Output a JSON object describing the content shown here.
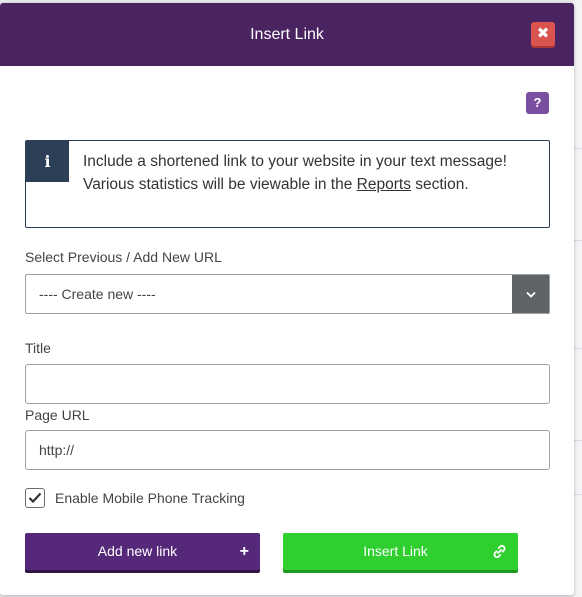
{
  "dialog": {
    "title": "Insert Link",
    "close_icon": "close-icon",
    "help_label": "?"
  },
  "info": {
    "icon": "i",
    "text_before": "Include a shortened link to your website in your text message! Various statistics will be viewable in the ",
    "link_text": "Reports",
    "text_after": " section."
  },
  "form": {
    "url_select": {
      "label": "Select Previous / Add New URL",
      "selected": "---- Create new ----"
    },
    "title_field": {
      "label": "Title",
      "value": ""
    },
    "page_url_field": {
      "label": "Page URL",
      "value": "http://"
    },
    "tracking": {
      "label": "Enable Mobile Phone Tracking",
      "checked": true
    }
  },
  "buttons": {
    "add_new_link": "Add new link",
    "add_icon": "+",
    "insert_link": "Insert Link",
    "insert_icon": "link-icon"
  },
  "colors": {
    "header": "#4a2460",
    "close": "#d9534f",
    "help": "#7b4fa0",
    "info_accent": "#2d3e57",
    "add_button": "#55287a",
    "insert_button": "#2ecf2e"
  }
}
